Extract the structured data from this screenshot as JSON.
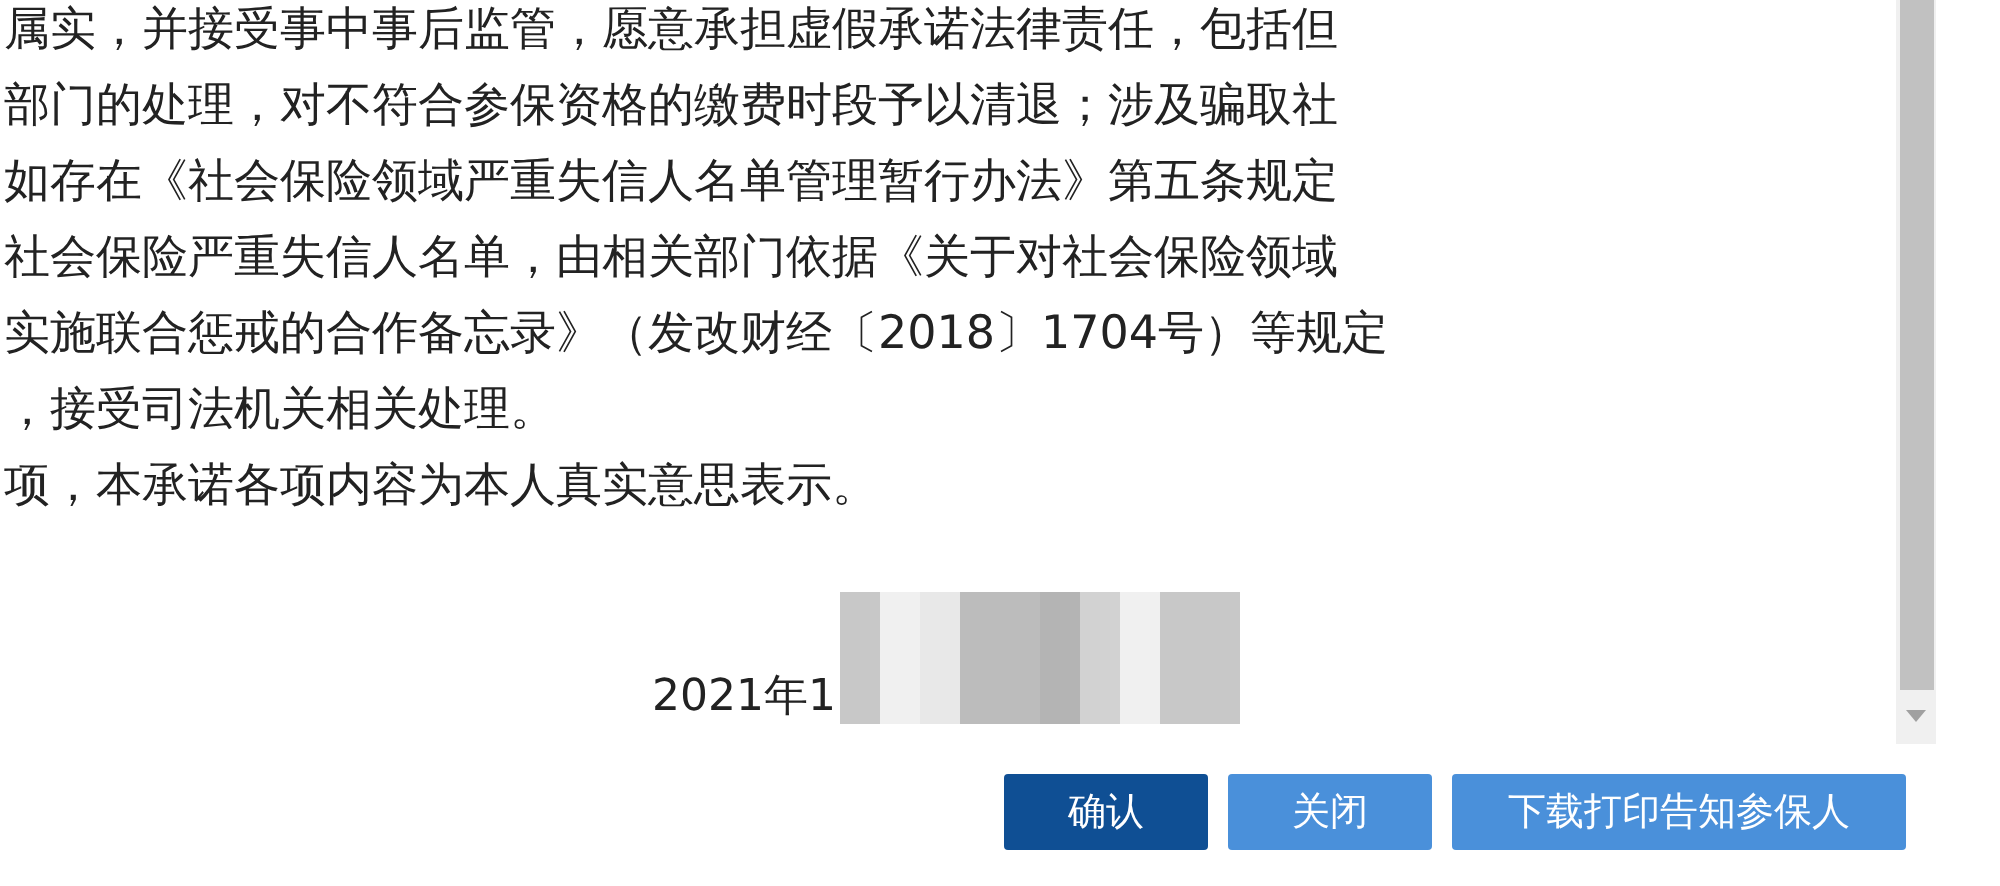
{
  "document": {
    "lines": [
      "属实，并接受事中事后监管，愿意承担虚假承诺法律责任，包括但",
      "部门的处理，对不符合参保资格的缴费时段予以清退；涉及骗取社",
      "如存在《社会保险领域严重失信人名单管理暂行办法》第五条规定",
      "社会保险严重失信人名单，由相关部门依据《关于对社会保险领域",
      "实施联合惩戒的合作备忘录》（发改财经〔2018〕1704号）等规定",
      "，接受司法机关相关处理。",
      "项，本承诺各项内容为本人真实意思表示。"
    ],
    "date": "2021年1"
  },
  "buttons": [
    {
      "label": "确认",
      "kind": "primary"
    },
    {
      "label": "关闭",
      "kind": "secondary"
    },
    {
      "label": "下载打印告知参保人",
      "kind": "secondary"
    }
  ]
}
